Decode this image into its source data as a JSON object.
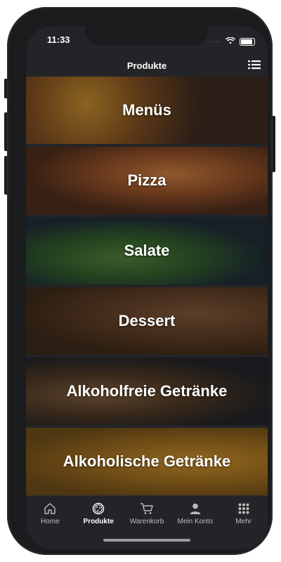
{
  "status": {
    "time": "11:33"
  },
  "header": {
    "title": "Produkte"
  },
  "categories": [
    {
      "label": "Menüs"
    },
    {
      "label": "Pizza"
    },
    {
      "label": "Salate"
    },
    {
      "label": "Dessert"
    },
    {
      "label": "Alkoholfreie Getränke"
    },
    {
      "label": "Alkoholische Getränke"
    }
  ],
  "tabbar": {
    "tabs": [
      {
        "label": "Home",
        "icon": "home-icon"
      },
      {
        "label": "Produkte",
        "icon": "pizza-icon"
      },
      {
        "label": "Warenkorb",
        "icon": "cart-icon"
      },
      {
        "label": "Mein Konto",
        "icon": "user-icon"
      },
      {
        "label": "Mehr",
        "icon": "grid-icon"
      }
    ],
    "active": "Produkte"
  }
}
